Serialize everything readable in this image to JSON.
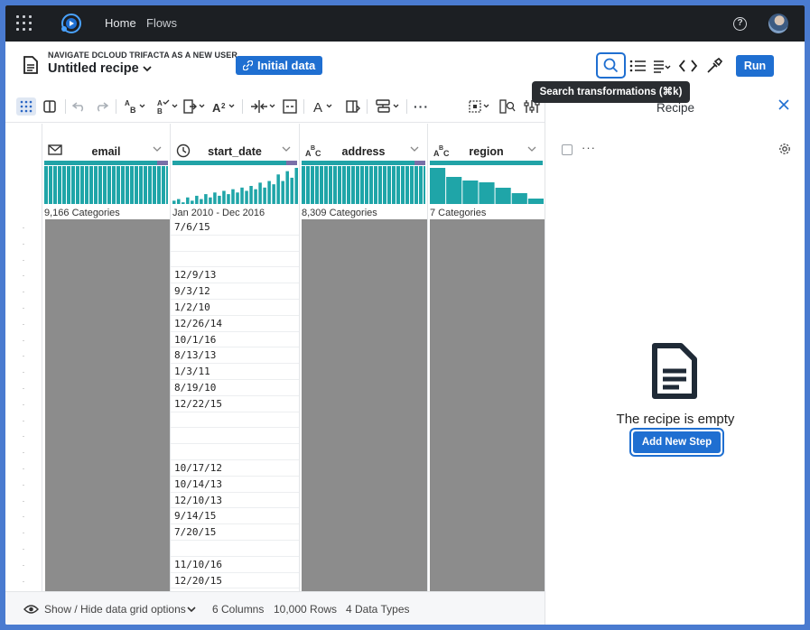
{
  "nav": {
    "home": "Home",
    "flows": "Flows",
    "help": "?"
  },
  "recipe": {
    "kicker": "NAVIGATE DCLOUD TRIFACTA AS A NEW USER",
    "title": "Untitled recipe",
    "initial_data": "Initial data",
    "run": "Run",
    "search_tooltip": "Search transformations (⌘k)"
  },
  "panel": {
    "title": "Recipe",
    "empty_text": "The recipe is empty",
    "add_step": "Add New Step"
  },
  "columns": [
    {
      "name": "email",
      "type_icon": "envelope-icon",
      "summary": "9,166 Categories"
    },
    {
      "name": "start_date",
      "type_icon": "clock-icon",
      "summary": "Jan 2010 - Dec 2016"
    },
    {
      "name": "address",
      "type_icon": "abc-icon",
      "summary": "8,309 Categories"
    },
    {
      "name": "region",
      "type_icon": "abc-icon",
      "summary": "7 Categories"
    }
  ],
  "start_date_values": [
    "7/6/15",
    "",
    "",
    "12/9/13",
    "9/3/12",
    "1/2/10",
    "12/26/14",
    "10/1/16",
    "8/13/13",
    "1/3/11",
    "8/19/10",
    "12/22/15",
    "",
    "",
    "",
    "10/17/12",
    "10/14/13",
    "12/10/13",
    "9/14/15",
    "7/20/15",
    "",
    "11/10/16",
    "12/20/15"
  ],
  "row_markers": [
    ".",
    ".",
    ".",
    ".",
    ".",
    ".",
    ".",
    ".",
    ".",
    ".",
    ".",
    ".",
    ".",
    ".",
    ".",
    ".",
    ".",
    ".",
    ".",
    ".",
    ".",
    ".",
    "."
  ],
  "start_date_histogram": [
    2,
    3,
    1,
    4,
    2,
    5,
    3,
    6,
    4,
    7,
    5,
    8,
    6,
    9,
    7,
    10,
    8,
    11,
    9,
    13,
    10,
    14,
    12,
    18,
    14,
    20,
    16,
    22
  ],
  "region_histogram": [
    40,
    30,
    26,
    24,
    18,
    12,
    6
  ],
  "footer": {
    "toggle": "Show / Hide data grid options",
    "columns": "6 Columns",
    "rows": "10,000 Rows",
    "types": "4 Data Types"
  },
  "colors": {
    "accent": "#1f6fd1",
    "quality_bar": "#21a3a7",
    "nav_bg": "#1c1f23"
  }
}
